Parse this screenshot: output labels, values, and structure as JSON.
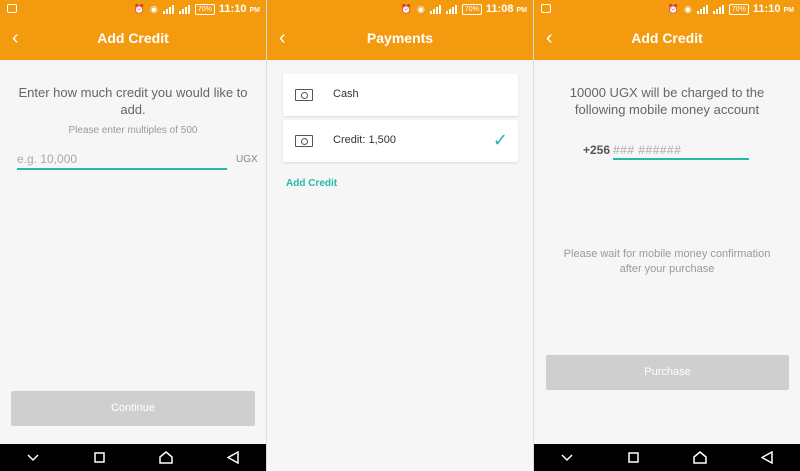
{
  "status": {
    "battery": "70%",
    "screens": [
      {
        "time": "11:10",
        "ampm": "PM"
      },
      {
        "time": "11:08",
        "ampm": "PM"
      },
      {
        "time": "11:10",
        "ampm": "PM"
      }
    ]
  },
  "add_credit": {
    "title": "Add Credit",
    "back_icon": "back-arrow-icon",
    "prompt": "Enter how much credit you would like to add.",
    "hint": "Please enter multiples of 500",
    "amount_placeholder": "e.g. 10,000",
    "amount_value": "",
    "unit": "UGX",
    "continue_label": "Continue"
  },
  "payments": {
    "title": "Payments",
    "back_icon": "back-arrow-icon",
    "methods": [
      {
        "label": "Cash",
        "icon": "cash-icon",
        "selected": false
      },
      {
        "label": "Credit: 1,500",
        "icon": "cash-icon",
        "selected": true
      }
    ],
    "add_credit_link": "Add Credit"
  },
  "confirm_credit": {
    "title": "Add Credit",
    "back_icon": "back-arrow-icon",
    "message": "10000 UGX will be charged to the following mobile money account",
    "country_code": "+256",
    "phone_placeholder": "### ######",
    "phone_value": "",
    "wait_message": "Please wait for mobile money confirmation after your purchase",
    "purchase_label": "Purchase"
  },
  "colors": {
    "accent": "#f39a0f",
    "teal": "#27b9a5",
    "disabled_button": "#cfcfcf",
    "navbar": "#000000"
  }
}
